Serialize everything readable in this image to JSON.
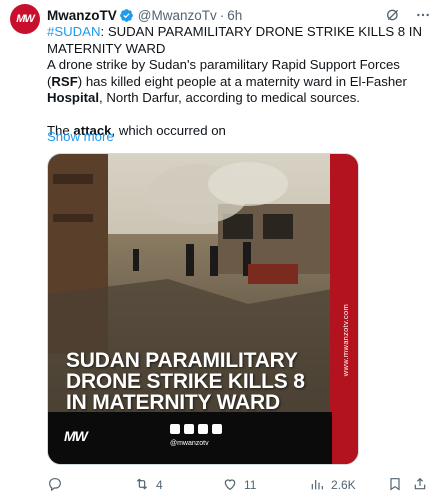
{
  "tweet": {
    "display_name": "MwanzoTV",
    "handle": "@MwanzoTv",
    "separator": "·",
    "time": "6h",
    "avatar_text": "MW",
    "hashtag": "#SUDAN",
    "headline_text": ": SUDAN PARAMILITARY DRONE STRIKE KILLS 8 IN MATERNITY WARD",
    "para1_a": "A drone strike by Sudan's paramilitary Rapid Support Forces (",
    "para1_b": "RSF",
    "para1_c": ") has killed eight people at a maternity ward in El-Fasher ",
    "para1_d": "Hospital",
    "para1_e": ", North Darfur, according to medical sources.",
    "para2_a": "The ",
    "para2_b": "attack",
    "para2_c": ", which occurred on",
    "show_more": "Show more"
  },
  "media": {
    "headline_lines": [
      "SUDAN PARAMILITARY",
      "DRONE STRIKE KILLS 8",
      "IN MATERNITY WARD"
    ],
    "site_vertical": "www.mwanzotv.com",
    "footer_logo": "MW",
    "footer_handle": "@mwanzotv",
    "social_icons": [
      "instagram-icon",
      "twitter-icon",
      "facebook-icon",
      "youtube-icon"
    ]
  },
  "actions": {
    "replies": "",
    "retweets": "4",
    "likes": "11",
    "views": "2.6K"
  },
  "colors": {
    "brand_red": "#c8102e",
    "link_blue": "#1d9bf0",
    "secondary_text": "#536471",
    "verified_blue": "#1d9bf0"
  }
}
